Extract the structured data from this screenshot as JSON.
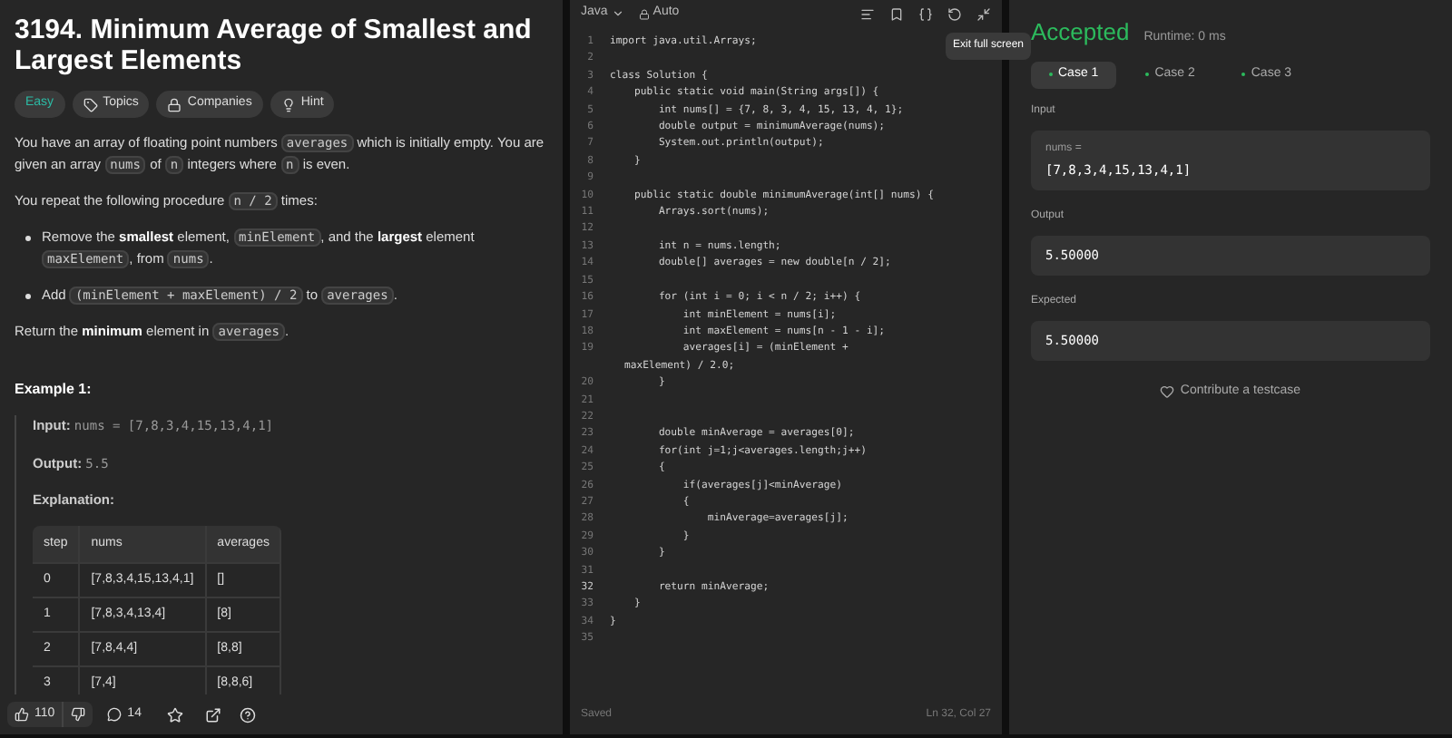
{
  "problem": {
    "title": "3194. Minimum Average of Smallest and Largest Elements",
    "tags": [
      {
        "kind": "difficulty",
        "label": "Easy"
      },
      {
        "kind": "topics",
        "label": "Topics"
      },
      {
        "kind": "companies",
        "label": "Companies"
      },
      {
        "kind": "hint",
        "label": "Hint"
      }
    ],
    "description": [
      {
        "kind": "paragraph",
        "segments": [
          {
            "kind": "text",
            "text": "You have an array of floating point numbers "
          },
          {
            "kind": "code",
            "text": "averages"
          },
          {
            "kind": "text",
            "text": " which is initially empty. You are given an array "
          },
          {
            "kind": "code",
            "text": "nums"
          },
          {
            "kind": "text",
            "text": " of "
          },
          {
            "kind": "code",
            "text": "n"
          },
          {
            "kind": "text",
            "text": " integers where "
          },
          {
            "kind": "code",
            "text": "n"
          },
          {
            "kind": "text",
            "text": " is even."
          }
        ]
      },
      {
        "kind": "paragraph",
        "segments": [
          {
            "kind": "text",
            "text": "You repeat the following procedure "
          },
          {
            "kind": "code",
            "text": "n / 2"
          },
          {
            "kind": "text",
            "text": " times:"
          }
        ]
      },
      {
        "kind": "bullet",
        "segments": [
          {
            "kind": "text",
            "text": "Remove the "
          },
          {
            "kind": "bold",
            "text": "smallest"
          },
          {
            "kind": "text",
            "text": " element, "
          },
          {
            "kind": "code",
            "text": "minElement"
          },
          {
            "kind": "text",
            "text": ", and the "
          },
          {
            "kind": "bold",
            "text": "largest"
          },
          {
            "kind": "text",
            "text": " element "
          },
          {
            "kind": "code",
            "text": "maxElement"
          },
          {
            "kind": "text",
            "text": ", from "
          },
          {
            "kind": "code",
            "text": "nums"
          },
          {
            "kind": "text",
            "text": "."
          }
        ]
      },
      {
        "kind": "bullet",
        "segments": [
          {
            "kind": "text",
            "text": "Add "
          },
          {
            "kind": "code",
            "text": "(minElement + maxElement) / 2"
          },
          {
            "kind": "text",
            "text": " to "
          },
          {
            "kind": "code",
            "text": "averages"
          },
          {
            "kind": "text",
            "text": "."
          }
        ]
      },
      {
        "kind": "paragraph",
        "segments": [
          {
            "kind": "text",
            "text": "Return the "
          },
          {
            "kind": "bold",
            "text": "minimum"
          },
          {
            "kind": "text",
            "text": " element in "
          },
          {
            "kind": "code",
            "text": "averages"
          },
          {
            "kind": "text",
            "text": "."
          }
        ]
      }
    ],
    "example": {
      "title": "Example 1:",
      "input_label": "Input:",
      "input": "nums = [7,8,3,4,15,13,4,1]",
      "output_label": "Output:",
      "output": "5.5",
      "explanation_label": "Explanation:",
      "table": {
        "columns": [
          "step",
          "nums",
          "averages"
        ],
        "rows": [
          [
            "0",
            "[7,8,3,4,15,13,4,1]",
            "[]"
          ],
          [
            "1",
            "[7,8,3,4,13,4]",
            "[8]"
          ],
          [
            "2",
            "[7,8,4,4]",
            "[8,8]"
          ],
          [
            "3",
            "[7,4]",
            "[8,8,6]"
          ]
        ]
      }
    },
    "footer": {
      "likes": "110",
      "comments": "14"
    }
  },
  "editor": {
    "language": "Java",
    "mode": "Auto",
    "tooltip": "Exit full screen",
    "lines": [
      {
        "number": "1",
        "text": "import java.util.Arrays;"
      },
      {
        "number": "2"
      },
      {
        "number": "3",
        "text": "class Solution {"
      },
      {
        "number": "4",
        "text": "    public static void main(String args[]) {"
      },
      {
        "number": "5",
        "text": "        int nums[] = {7, 8, 3, 4, 15, 13, 4, 1};"
      },
      {
        "number": "6",
        "text": "        double output = minimumAverage(nums);"
      },
      {
        "number": "7",
        "text": "        System.out.println(output);"
      },
      {
        "number": "8",
        "text": "    }"
      },
      {
        "number": "9"
      },
      {
        "number": "10",
        "text": "    public static double minimumAverage(int[] nums) {"
      },
      {
        "number": "11",
        "text": "        Arrays.sort(nums);"
      },
      {
        "number": "12"
      },
      {
        "number": "13",
        "text": "        int n = nums.length;"
      },
      {
        "number": "14",
        "text": "        double[] averages = new double[n / 2];"
      },
      {
        "number": "15"
      },
      {
        "number": "16",
        "text": "        for (int i = 0; i < n / 2; i++) {"
      },
      {
        "number": "17",
        "text": "            int minElement = nums[i];"
      },
      {
        "number": "18",
        "text": "            int maxElement = nums[n - 1 - i];"
      },
      {
        "number": "19",
        "text": "            averages[i] = (minElement +",
        "wrap": "maxElement) / 2.0;"
      },
      {
        "number": "20",
        "text": "        }"
      },
      {
        "number": "21"
      },
      {
        "number": "22"
      },
      {
        "number": "23",
        "text": "        double minAverage = averages[0];"
      },
      {
        "number": "24",
        "text": "        for(int j=1;j<averages.length;j++)"
      },
      {
        "number": "25",
        "text": "        {"
      },
      {
        "number": "26",
        "text": "            if(averages[j]<minAverage)"
      },
      {
        "number": "27",
        "text": "            {"
      },
      {
        "number": "28",
        "text": "                minAverage=averages[j];"
      },
      {
        "number": "29",
        "text": "            }"
      },
      {
        "number": "30",
        "text": "        }"
      },
      {
        "number": "31"
      },
      {
        "number": "32",
        "text": "        return minAverage;"
      },
      {
        "number": "33",
        "text": "    }"
      },
      {
        "number": "34",
        "text": "}"
      },
      {
        "number": "35"
      }
    ],
    "status": "Saved",
    "cursor": "Ln 32, Col 27"
  },
  "result": {
    "verdict": "Accepted",
    "runtime": "Runtime: 0 ms",
    "cases": [
      {
        "label": "Case 1",
        "selected": true
      },
      {
        "label": "Case 2",
        "selected": false
      },
      {
        "label": "Case 3",
        "selected": false
      }
    ],
    "input_label": "Input",
    "input_name": "nums =",
    "input_value": "[7,8,3,4,15,13,4,1]",
    "output_label": "Output",
    "output_value": "5.50000",
    "expected_label": "Expected",
    "expected_value": "5.50000",
    "contribute": "Contribute a testcase"
  }
}
